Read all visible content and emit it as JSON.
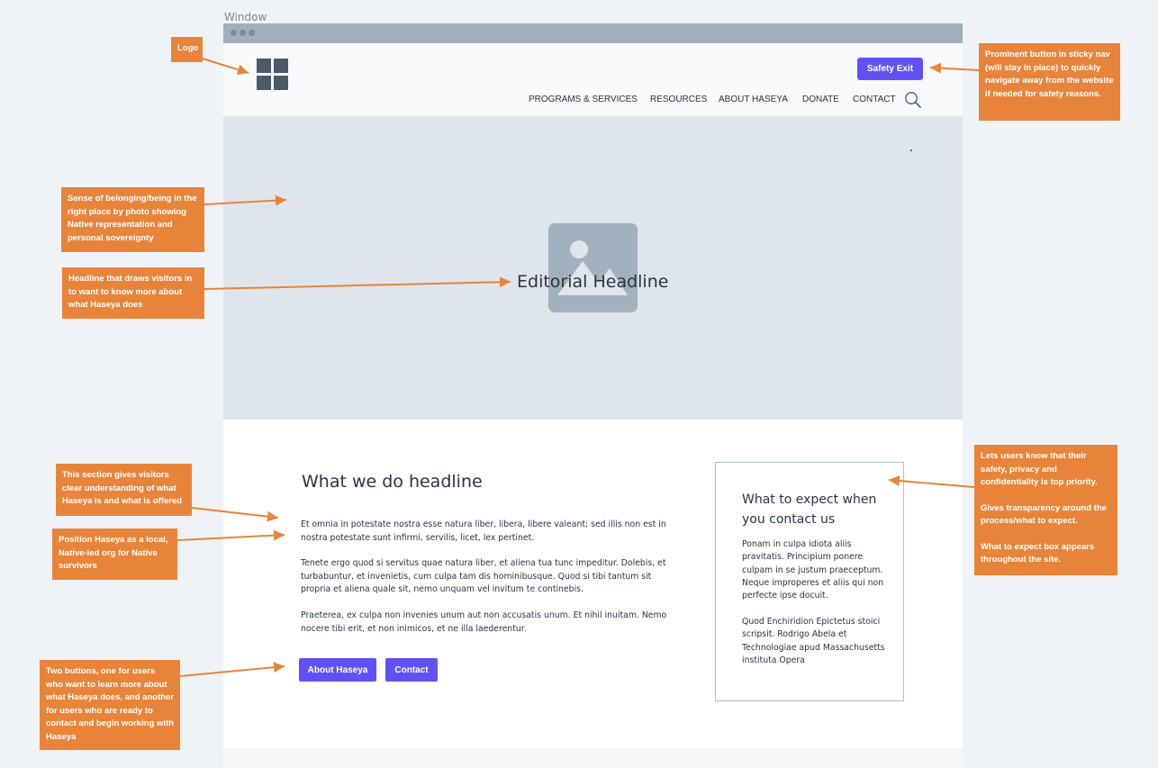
{
  "window_label": "Window",
  "nav": {
    "logo": "logo-icon",
    "safety_exit_label": "Safety Exit",
    "items": [
      "PROGRAMS & SERVICES",
      "RESOURCES",
      "ABOUT HASEYA",
      "DONATE",
      "CONTACT"
    ],
    "search_icon": "search-icon"
  },
  "hero": {
    "image_icon": "image-placeholder-icon",
    "headline": "Editorial Headline"
  },
  "main": {
    "headline": "What we do headline",
    "paragraphs": [
      "Et omnia in potestate nostra esse natura liber, libera, libere valeant; sed illis non est in nostra potestate sunt infirmi, servilis, licet, lex pertinet.",
      "Tenete ergo quod si servitus quae natura liber, et aliena tua tunc impeditur. Dolebis, et turbabuntur, et invenietis, cum culpa tam dis hominibusque. Quod si tibi tantum sit propria et aliena quale sit, nemo unquam vel invitum te continebis.",
      "Praeterea, ex culpa non invenies unum aut non accusatis unum. Et nihil inuitam. Nemo nocere tibi erit, et non inimicos, et ne illa laederentur."
    ],
    "buttons": [
      "About Haseya",
      "Contact"
    ]
  },
  "expect_box": {
    "title": "What to expect when you contact us",
    "paragraphs": [
      "Ponam in culpa idiota aliis pravitatis. Principium ponere culpam in se justum praeceptum. Neque improperes et aliis qui non perfecte ipse docuit.",
      "Quod Enchiridion Epictetus stoici scripsit. Rodrigo Abela et Technologiae apud Massachusetts instituta Opera"
    ]
  },
  "annotations": {
    "logo": "Logo",
    "safety": "Prominent button in sticky nav (will stay in place) to quickly navigate away from the website if needed for safety reasons.",
    "photo": "Sense of belonging/being in the right place by photo showing Native representation and personal sovereignty",
    "headline": "Headline that draws visitors in to want to know more about what Haseya does",
    "section": "This section gives visitors clear understanding of what Haseya is and what is offered",
    "position": "Position Haseya as a local, Native-led org for Native survivors",
    "buttons": "Two buttons, one for users who want to learn more about what Haseya does, and another for users who are ready to contact and begin working with Haseya",
    "expect": [
      "Lets users know that their safety, privacy and confidentiality is top priority.",
      "Gives transparency around the process/what to expect.",
      "What to expect box appears throughout the site."
    ]
  },
  "colors": {
    "accent": "#6151f5",
    "annotation": "#e8843a",
    "hero_bg": "#dfe5ec",
    "titlebar": "#a1afbd"
  }
}
